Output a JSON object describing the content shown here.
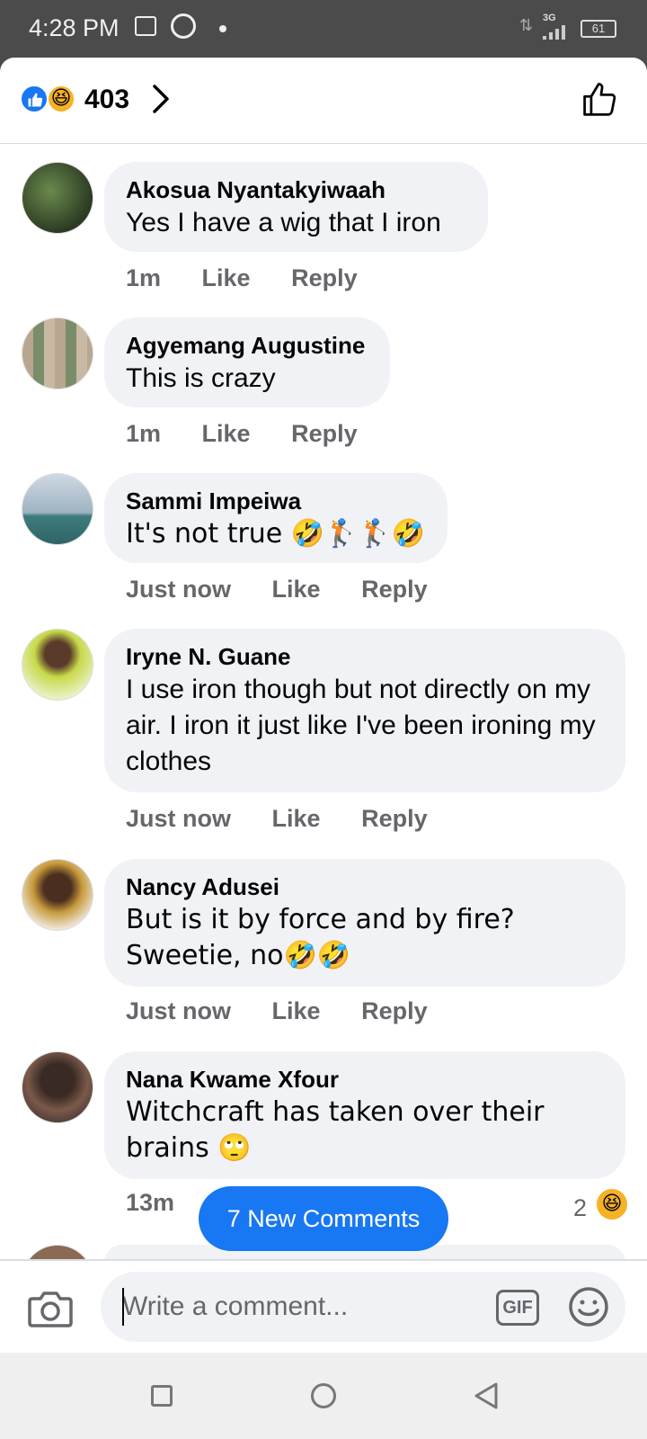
{
  "status_bar": {
    "time": "4:28 PM",
    "network": "3G",
    "battery": "61",
    "icons": [
      "gallery-icon",
      "whatsapp-icon",
      "notification-dot-icon",
      "data-arrows-icon",
      "signal-icon",
      "battery-icon"
    ]
  },
  "header": {
    "reaction_count": "403",
    "reactions": [
      "like",
      "haha"
    ]
  },
  "comments": [
    {
      "author": "Akosua Nyantakyiwaah",
      "text": "Yes I have a wig that I iron",
      "time": "1m",
      "like": "Like",
      "reply": "Reply"
    },
    {
      "author": "Agyemang Augustine",
      "text": "This is crazy",
      "time": "1m",
      "like": "Like",
      "reply": "Reply"
    },
    {
      "author": "Sammi Impeiwa",
      "text": "It's not true 🤣🏌️🏌️🤣",
      "time": "Just now",
      "like": "Like",
      "reply": "Reply"
    },
    {
      "author": "Iryne N. Guane",
      "text": "I use iron though but not directly on my air. I iron it just like I've been ironing my clothes",
      "time": "Just now",
      "like": "Like",
      "reply": "Reply"
    },
    {
      "author": "Nancy Adusei",
      "text": "But is it by force and by fire? Sweetie, no🤣🤣",
      "time": "Just now",
      "like": "Like",
      "reply": "Reply"
    },
    {
      "author": "Nana Kwame Xfour",
      "text": "Witchcraft has taken over their brains 🙄",
      "time": "13m",
      "reaction_count": "2"
    }
  ],
  "new_comments_label": "7 New Comments",
  "composer": {
    "placeholder": "Write a comment...",
    "gif_label": "GIF"
  },
  "colors": {
    "accent": "#1877f2",
    "bubble": "#f0f2f5",
    "meta_text": "#65676b",
    "haha": "#f7b125"
  }
}
